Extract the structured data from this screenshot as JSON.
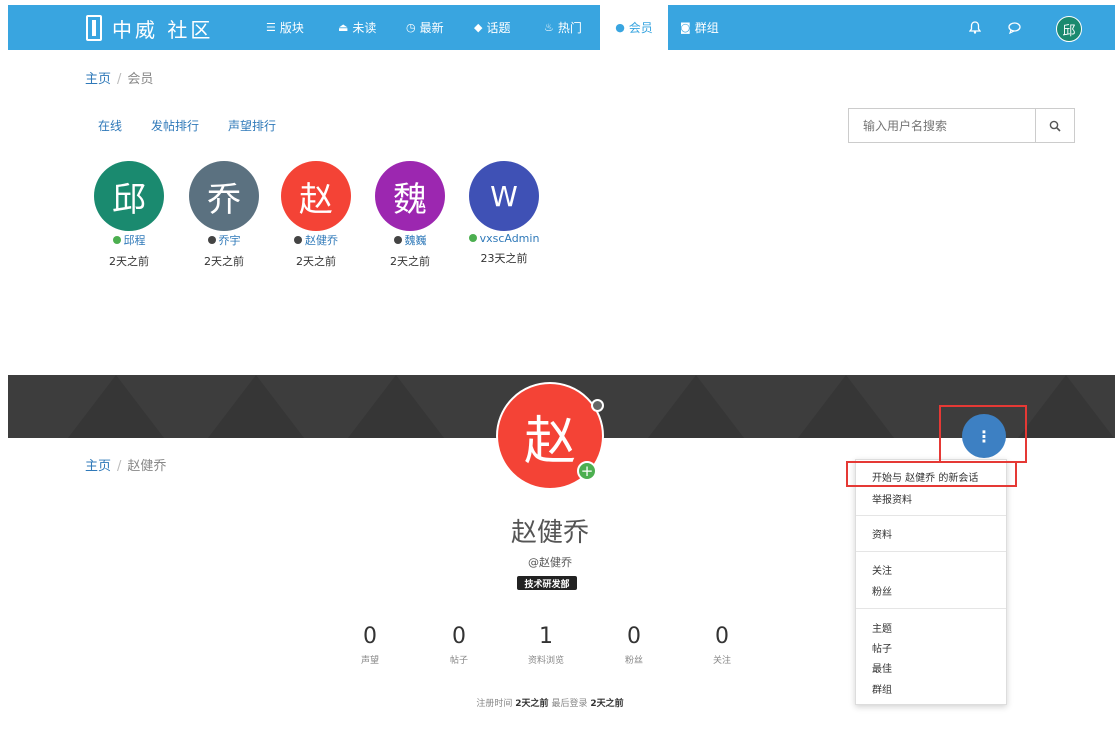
{
  "navbar": {
    "logo_text": "中威 社区",
    "items": [
      {
        "icon": "list-icon",
        "glyph": "☰",
        "label": "版块"
      },
      {
        "icon": "inbox-icon",
        "glyph": "⏏",
        "label": "未读"
      },
      {
        "icon": "clock-icon",
        "glyph": "◷",
        "label": "最新"
      },
      {
        "icon": "tag-icon",
        "glyph": "◆",
        "label": "话题"
      },
      {
        "icon": "fire-icon",
        "glyph": "♨",
        "label": "热门"
      },
      {
        "icon": "user-icon",
        "glyph": "●",
        "label": "会员"
      },
      {
        "icon": "group-icon",
        "glyph": "◙",
        "label": "群组"
      }
    ],
    "active_item": "会员",
    "user_avatar": "邱"
  },
  "members_page": {
    "breadcrumb": {
      "home": "主页",
      "sep": "/",
      "current": "会员"
    },
    "filters": [
      "在线",
      "发帖排行",
      "声望排行"
    ],
    "search": {
      "placeholder": "输入用户名搜索"
    },
    "members": [
      {
        "avatar": "邱",
        "color": "#1a8a6f",
        "name": "邱程",
        "online": true,
        "time": "2天之前"
      },
      {
        "avatar": "乔",
        "color": "#5b7180",
        "name": "乔宇",
        "online": false,
        "time": "2天之前"
      },
      {
        "avatar": "赵",
        "color": "#f44336",
        "name": "赵健乔",
        "online": false,
        "time": "2天之前"
      },
      {
        "avatar": "魏",
        "color": "#9c27b0",
        "name": "魏巍",
        "online": false,
        "time": "2天之前"
      },
      {
        "avatar": "W",
        "color": "#3f51b5",
        "name": "vxscAdmin",
        "online": true,
        "time": "23天之前"
      }
    ]
  },
  "profile_page": {
    "breadcrumb": {
      "home": "主页",
      "sep": "/",
      "current": "赵健乔"
    },
    "avatar": "赵",
    "avatar_add": "+",
    "name": "赵健乔",
    "handle": "@赵健乔",
    "group_badge": "技术研发部",
    "stats": [
      {
        "value": "0",
        "label": "声望"
      },
      {
        "value": "0",
        "label": "帖子"
      },
      {
        "value": "1",
        "label": "资料浏览"
      },
      {
        "value": "0",
        "label": "粉丝"
      },
      {
        "value": "0",
        "label": "关注"
      }
    ],
    "registration": {
      "reg_label": "注册时间",
      "reg_value": "2天之前",
      "login_label": "最后登录",
      "login_value": "2天之前"
    },
    "menu_button_glyph": "⋮",
    "dropdown": {
      "items": [
        "开始与 赵健乔 的新会话",
        "举报资料",
        "资料",
        "关注",
        "粉丝",
        "主题",
        "帖子",
        "最佳",
        "群组"
      ]
    }
  },
  "colors": {
    "navbar": "#39a5e0",
    "link": "#2f79b9",
    "highlight_box": "#e53935",
    "online": "#4caf50",
    "offline": "#444444"
  }
}
